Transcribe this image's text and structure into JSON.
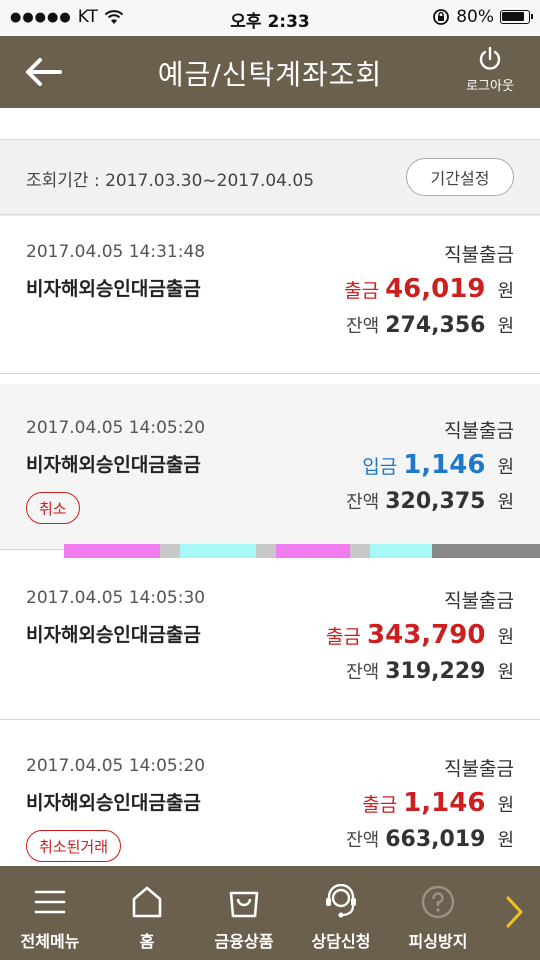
{
  "status_bar": {
    "carrier": "KT",
    "time": "오후 2:33",
    "battery": "80%"
  },
  "header": {
    "title": "예금/신탁계좌조회",
    "logout_label": "로그아웃"
  },
  "period": {
    "label": "조회기간 : 2017.03.30~2017.04.05",
    "button": "기간설정"
  },
  "transactions": [
    {
      "datetime": "2017.04.05 14:31:48",
      "kind": "직불출금",
      "desc": "비자해외승인대금출금",
      "amount_type": "출금",
      "amount": "46,019",
      "unit": "원",
      "balance_label": "잔액",
      "balance": "274,356",
      "balance_unit": "원"
    },
    {
      "datetime": "2017.04.05 14:05:20",
      "kind": "직불출금",
      "desc": "비자해외승인대금출금",
      "amount_type": "입금",
      "amount": "1,146",
      "unit": "원",
      "balance_label": "잔액",
      "balance": "320,375",
      "balance_unit": "원",
      "badge": "취소"
    },
    {
      "datetime": "2017.04.05 14:05:30",
      "kind": "직불출금",
      "desc": "비자해외승인대금출금",
      "amount_type": "출금",
      "amount": "343,790",
      "unit": "원",
      "balance_label": "잔액",
      "balance": "319,229",
      "balance_unit": "원"
    },
    {
      "datetime": "2017.04.05 14:05:20",
      "kind": "직불출금",
      "desc": "비자해외승인대금출금",
      "amount_type": "출금",
      "amount": "1,146",
      "unit": "원",
      "balance_label": "잔액",
      "balance": "663,019",
      "balance_unit": "원",
      "badge": "취소된거래"
    }
  ],
  "tabbar": {
    "items": [
      {
        "label": "전체메뉴",
        "icon": "hamburger-icon"
      },
      {
        "label": "홈",
        "icon": "home-icon"
      },
      {
        "label": "금융상품",
        "icon": "shopping-bag-icon"
      },
      {
        "label": "상담신청",
        "icon": "headset-icon"
      },
      {
        "label": "피싱방지",
        "icon": "question-circle-icon"
      }
    ]
  },
  "colors": {
    "brand": "#6b5f4d",
    "withdraw": "#cc1f1f",
    "deposit": "#1f78c8"
  }
}
